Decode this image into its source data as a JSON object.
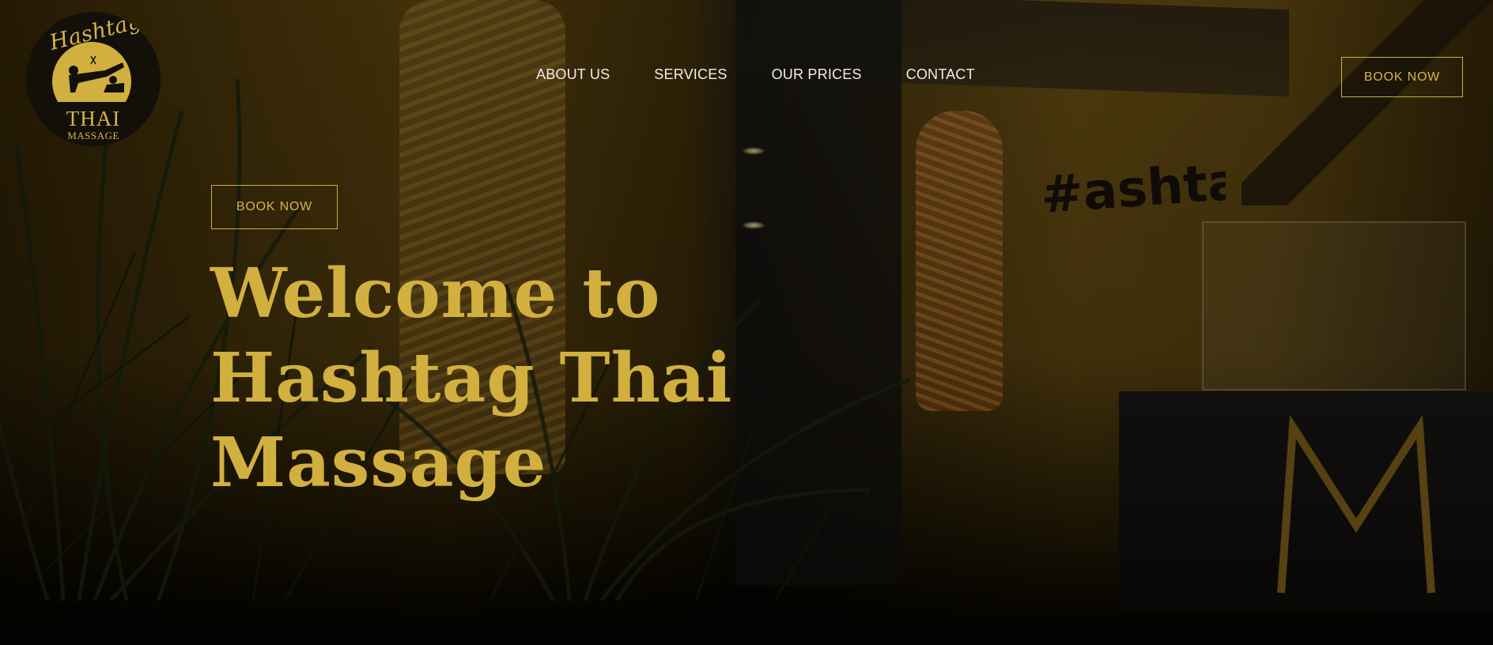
{
  "brand": {
    "logo_script": "Hashtag",
    "logo_main": "THAI",
    "logo_sub": "MASSAGE"
  },
  "nav": {
    "items": [
      {
        "label": "ABOUT US"
      },
      {
        "label": "SERVICES"
      },
      {
        "label": "OUR PRICES"
      },
      {
        "label": "CONTACT"
      }
    ]
  },
  "header": {
    "book_label": "BOOK NOW"
  },
  "hero": {
    "book_label": "BOOK NOW",
    "headline_lines": [
      "Welcome to",
      "Hashtag Thai",
      "Massage"
    ],
    "wall_sign": "#ashtag"
  },
  "colors": {
    "accent_gold": "#d2b03f",
    "nav_text": "#f2eee4",
    "logo_bg": "#121009"
  },
  "icons": {
    "logo_figure": "massage-figures-icon"
  }
}
